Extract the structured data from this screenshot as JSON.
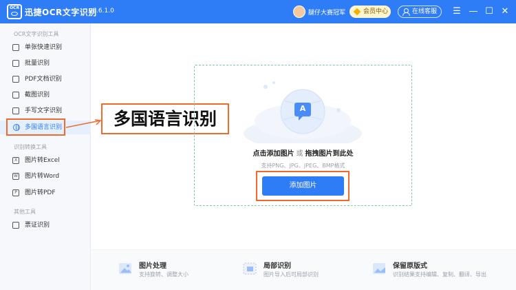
{
  "titlebar": {
    "logo_text": "OCR",
    "app_title": "迅捷OCR文字识别",
    "version": "v8.6.1.0",
    "user_name": "腿仔大赛冠军",
    "vip_label": "会员中心",
    "service_label": "在线客服",
    "menu_glyph": "☰",
    "min_glyph": "—",
    "max_glyph": "☐",
    "close_glyph": "✕"
  },
  "sidebar": {
    "groups": [
      {
        "label": "OCR文字识别工具"
      },
      {
        "label": "识别转换工具"
      },
      {
        "label": "其他工具"
      }
    ],
    "items": [
      {
        "label": "单张快速识别",
        "icon": "image-doc-icon"
      },
      {
        "label": "批量识别",
        "icon": "batch-icon"
      },
      {
        "label": "PDF文档识别",
        "icon": "pdf-icon"
      },
      {
        "label": "截图识别",
        "icon": "screenshot-icon"
      },
      {
        "label": "手写文字识别",
        "icon": "pen-icon"
      },
      {
        "label": "多国语言识别",
        "icon": "globe-icon",
        "active": true
      },
      {
        "label": "图片转Excel",
        "icon": "excel-icon",
        "glyph": "X"
      },
      {
        "label": "图片转Word",
        "icon": "word-icon",
        "glyph": "W"
      },
      {
        "label": "图片转PDF",
        "icon": "pdf-convert-icon",
        "glyph": "P"
      },
      {
        "label": "票证识别",
        "icon": "ticket-icon"
      }
    ]
  },
  "callout": {
    "label": "多国语言识别"
  },
  "dropzone": {
    "illustration_letter": "A",
    "prompt_part1": "点击添加图片",
    "prompt_or": "或",
    "prompt_part2": "拖拽图片到此处",
    "formats": "支持PNG、JPG、JPEG、BMP格式",
    "add_button": "添加图片"
  },
  "features": [
    {
      "title": "图片处理",
      "desc": "支持旋转、调整大小",
      "icon": "image-process-icon"
    },
    {
      "title": "局部识别",
      "desc": "图片导入后可局部识别",
      "icon": "partial-select-icon"
    },
    {
      "title": "保留原版式",
      "desc": "识别结果支持编辑、复制、翻译、导出",
      "icon": "layout-keep-icon"
    }
  ],
  "colors": {
    "primary": "#2f7df6",
    "highlight": "#f06a2b",
    "dashed_border": "#7fc9a8"
  }
}
